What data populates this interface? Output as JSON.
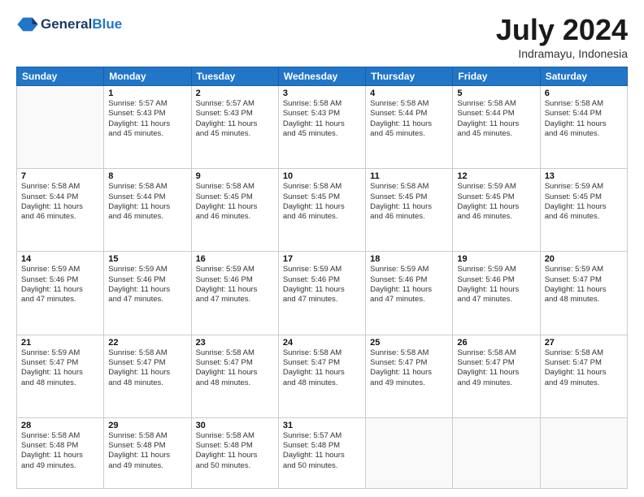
{
  "logo": {
    "general": "General",
    "blue": "Blue"
  },
  "header": {
    "month": "July 2024",
    "location": "Indramayu, Indonesia"
  },
  "weekdays": [
    "Sunday",
    "Monday",
    "Tuesday",
    "Wednesday",
    "Thursday",
    "Friday",
    "Saturday"
  ],
  "weeks": [
    [
      {
        "day": "",
        "info": ""
      },
      {
        "day": "1",
        "info": "Sunrise: 5:57 AM\nSunset: 5:43 PM\nDaylight: 11 hours\nand 45 minutes."
      },
      {
        "day": "2",
        "info": "Sunrise: 5:57 AM\nSunset: 5:43 PM\nDaylight: 11 hours\nand 45 minutes."
      },
      {
        "day": "3",
        "info": "Sunrise: 5:58 AM\nSunset: 5:43 PM\nDaylight: 11 hours\nand 45 minutes."
      },
      {
        "day": "4",
        "info": "Sunrise: 5:58 AM\nSunset: 5:44 PM\nDaylight: 11 hours\nand 45 minutes."
      },
      {
        "day": "5",
        "info": "Sunrise: 5:58 AM\nSunset: 5:44 PM\nDaylight: 11 hours\nand 45 minutes."
      },
      {
        "day": "6",
        "info": "Sunrise: 5:58 AM\nSunset: 5:44 PM\nDaylight: 11 hours\nand 46 minutes."
      }
    ],
    [
      {
        "day": "7",
        "info": "Sunrise: 5:58 AM\nSunset: 5:44 PM\nDaylight: 11 hours\nand 46 minutes."
      },
      {
        "day": "8",
        "info": "Sunrise: 5:58 AM\nSunset: 5:44 PM\nDaylight: 11 hours\nand 46 minutes."
      },
      {
        "day": "9",
        "info": "Sunrise: 5:58 AM\nSunset: 5:45 PM\nDaylight: 11 hours\nand 46 minutes."
      },
      {
        "day": "10",
        "info": "Sunrise: 5:58 AM\nSunset: 5:45 PM\nDaylight: 11 hours\nand 46 minutes."
      },
      {
        "day": "11",
        "info": "Sunrise: 5:58 AM\nSunset: 5:45 PM\nDaylight: 11 hours\nand 46 minutes."
      },
      {
        "day": "12",
        "info": "Sunrise: 5:59 AM\nSunset: 5:45 PM\nDaylight: 11 hours\nand 46 minutes."
      },
      {
        "day": "13",
        "info": "Sunrise: 5:59 AM\nSunset: 5:45 PM\nDaylight: 11 hours\nand 46 minutes."
      }
    ],
    [
      {
        "day": "14",
        "info": "Sunrise: 5:59 AM\nSunset: 5:46 PM\nDaylight: 11 hours\nand 47 minutes."
      },
      {
        "day": "15",
        "info": "Sunrise: 5:59 AM\nSunset: 5:46 PM\nDaylight: 11 hours\nand 47 minutes."
      },
      {
        "day": "16",
        "info": "Sunrise: 5:59 AM\nSunset: 5:46 PM\nDaylight: 11 hours\nand 47 minutes."
      },
      {
        "day": "17",
        "info": "Sunrise: 5:59 AM\nSunset: 5:46 PM\nDaylight: 11 hours\nand 47 minutes."
      },
      {
        "day": "18",
        "info": "Sunrise: 5:59 AM\nSunset: 5:46 PM\nDaylight: 11 hours\nand 47 minutes."
      },
      {
        "day": "19",
        "info": "Sunrise: 5:59 AM\nSunset: 5:46 PM\nDaylight: 11 hours\nand 47 minutes."
      },
      {
        "day": "20",
        "info": "Sunrise: 5:59 AM\nSunset: 5:47 PM\nDaylight: 11 hours\nand 48 minutes."
      }
    ],
    [
      {
        "day": "21",
        "info": "Sunrise: 5:59 AM\nSunset: 5:47 PM\nDaylight: 11 hours\nand 48 minutes."
      },
      {
        "day": "22",
        "info": "Sunrise: 5:58 AM\nSunset: 5:47 PM\nDaylight: 11 hours\nand 48 minutes."
      },
      {
        "day": "23",
        "info": "Sunrise: 5:58 AM\nSunset: 5:47 PM\nDaylight: 11 hours\nand 48 minutes."
      },
      {
        "day": "24",
        "info": "Sunrise: 5:58 AM\nSunset: 5:47 PM\nDaylight: 11 hours\nand 48 minutes."
      },
      {
        "day": "25",
        "info": "Sunrise: 5:58 AM\nSunset: 5:47 PM\nDaylight: 11 hours\nand 49 minutes."
      },
      {
        "day": "26",
        "info": "Sunrise: 5:58 AM\nSunset: 5:47 PM\nDaylight: 11 hours\nand 49 minutes."
      },
      {
        "day": "27",
        "info": "Sunrise: 5:58 AM\nSunset: 5:47 PM\nDaylight: 11 hours\nand 49 minutes."
      }
    ],
    [
      {
        "day": "28",
        "info": "Sunrise: 5:58 AM\nSunset: 5:48 PM\nDaylight: 11 hours\nand 49 minutes."
      },
      {
        "day": "29",
        "info": "Sunrise: 5:58 AM\nSunset: 5:48 PM\nDaylight: 11 hours\nand 49 minutes."
      },
      {
        "day": "30",
        "info": "Sunrise: 5:58 AM\nSunset: 5:48 PM\nDaylight: 11 hours\nand 50 minutes."
      },
      {
        "day": "31",
        "info": "Sunrise: 5:57 AM\nSunset: 5:48 PM\nDaylight: 11 hours\nand 50 minutes."
      },
      {
        "day": "",
        "info": ""
      },
      {
        "day": "",
        "info": ""
      },
      {
        "day": "",
        "info": ""
      }
    ]
  ]
}
